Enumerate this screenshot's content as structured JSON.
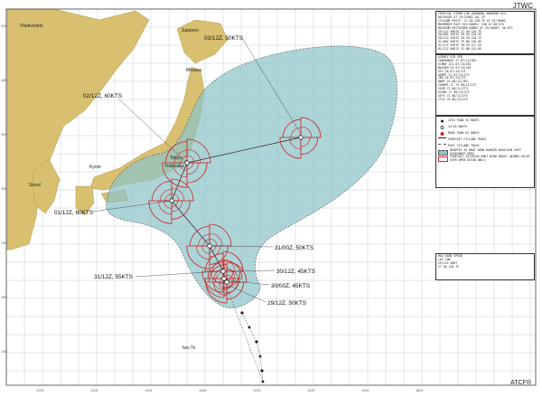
{
  "header": {
    "agency": "JTWC",
    "footer": "ATCF®"
  },
  "warning_text": [
    "TROPICAL STORM 13W (KHANUN) WARNING #14",
    "RELEASED AT 29/2100Z JUL 23",
    "CYCLONE POSIT: 27.2N 128.7E AT 29/1800Z",
    "MOVEMENT PAST SIX HOURS: 340 AT 08 KTS",
    "MAXIMUM SUSTAINED WINDS AT 29/1800Z: 50 KTS",
    "29/12Z  50KTS    27.2N 128.7E",
    "30/00Z  45KTS    28.1N 128.5E",
    "30/12Z  45KTS    28.7N 128.7E",
    "31/00Z  50KTS    29.6N 128.0E",
    "31/12Z  55KTS    30.7N 127.2E",
    "01/12Z  60KTS    32.8N 125.6E"
  ],
  "agency_table": {
    "header": [
      "AGENCY",
      "DIR",
      "SPD"
    ],
    "rows": [
      [
        "CONSENSUS",
        "27",
        "07/15/281"
      ],
      [
        "ECMWF",
        "231",
        "07/15/262"
      ],
      [
        "NAVGEM",
        "25",
        "07/14/263"
      ],
      [
        "GFS",
        "28",
        "07/14/271"
      ],
      [
        "UKMET",
        "21",
        "07/13/271"
      ],
      [
        "JMA",
        "26",
        "07/13/272"
      ],
      [
        "HWRF",
        "24",
        "08/12/263"
      ],
      [
        "COAMPS-TC",
        "73",
        "08/12/272"
      ],
      [
        "JGSM",
        "73",
        "08/12/273"
      ],
      [
        "ECENS",
        "71",
        "08/13/273"
      ],
      [
        "GEFS",
        "73",
        "08/13/275"
      ],
      [
        "CTCX",
        "76",
        "08/12/275"
      ]
    ]
  },
  "legend": {
    "items": [
      {
        "label": "LESS THAN 34 KNOTS",
        "kind": "dot"
      },
      {
        "label": "34-63 KNOTS",
        "kind": "ring"
      },
      {
        "label": "MORE THAN 63 KNOTS",
        "kind": "storm"
      },
      {
        "label": "FORECAST CYCLONE TRACK",
        "kind": "line"
      },
      {
        "label": "PAST CYCLONE TRACK",
        "kind": "dashed"
      },
      {
        "label": "DENOTES 34 KNOT WIND DANGER AREA/USN SHIP AVOIDANCE AREA",
        "kind": "cone"
      },
      {
        "label": "FORECAST 34/50/64 KNOT WIND RADII (WINDS VALID OVER OPEN OCEAN ONLY)",
        "kind": "radii"
      }
    ]
  },
  "key_text": [
    "MAX WIND SPEED",
    "LAT    LON",
    "29/12Z  50KT",
    "27.2N  128.7E"
  ],
  "places": [
    "Vladivostok",
    "Sapporo",
    "Misawa",
    "Tokyo",
    "Yokosuka",
    "Kyoto",
    "Seoul",
    "Iwo To"
  ],
  "forecast_labels": [
    "03/12Z, 50KTS",
    "02/12Z, 60KTS",
    "01/12Z, 60KTS",
    "31/00Z, 50KTS",
    "31/12Z, 55KTS",
    "30/12Z, 45KTS",
    "30/00Z, 45KTS",
    "29/12Z, 50KTS"
  ],
  "axis": {
    "lon_ticks": [
      "125E",
      "130E",
      "135E",
      "140E",
      "145E",
      "150E",
      "155E",
      "160E"
    ],
    "lat_ticks": [
      "45N",
      "40N",
      "35N",
      "30N",
      "25N",
      "20N",
      "15N"
    ]
  },
  "colors": {
    "ocean": "#ffffff",
    "land": "#d8c070",
    "cone": "#8ec3c8",
    "track": "#222222",
    "radii": "#cc2222",
    "grid": "#b8c4cc",
    "past_track": "#555555"
  }
}
